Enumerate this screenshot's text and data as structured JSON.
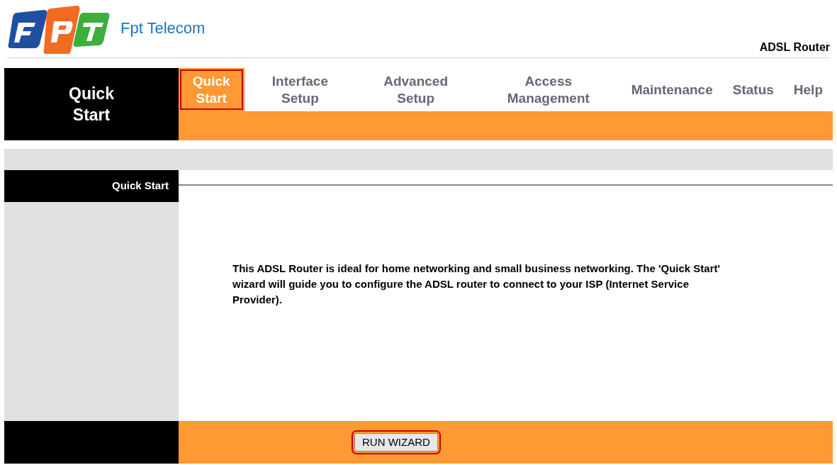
{
  "header": {
    "brand": "Fpt Telecom",
    "product": "ADSL Router"
  },
  "nav": {
    "section_title": "Quick Start",
    "tabs": [
      {
        "label": "Quick Start",
        "selected": true
      },
      {
        "label": "Interface Setup",
        "selected": false
      },
      {
        "label": "Advanced Setup",
        "selected": false
      },
      {
        "label": "Access Management",
        "selected": false
      },
      {
        "label": "Maintenance",
        "selected": false
      },
      {
        "label": "Status",
        "selected": false
      },
      {
        "label": "Help",
        "selected": false
      }
    ]
  },
  "section": {
    "label": "Quick Start",
    "description": "This ADSL Router is ideal for home networking and small business networking. The 'Quick Start' wizard will guide you to configure the ADSL router to connect to your ISP (Internet Service Provider)."
  },
  "footer": {
    "button": "RUN WIZARD"
  }
}
